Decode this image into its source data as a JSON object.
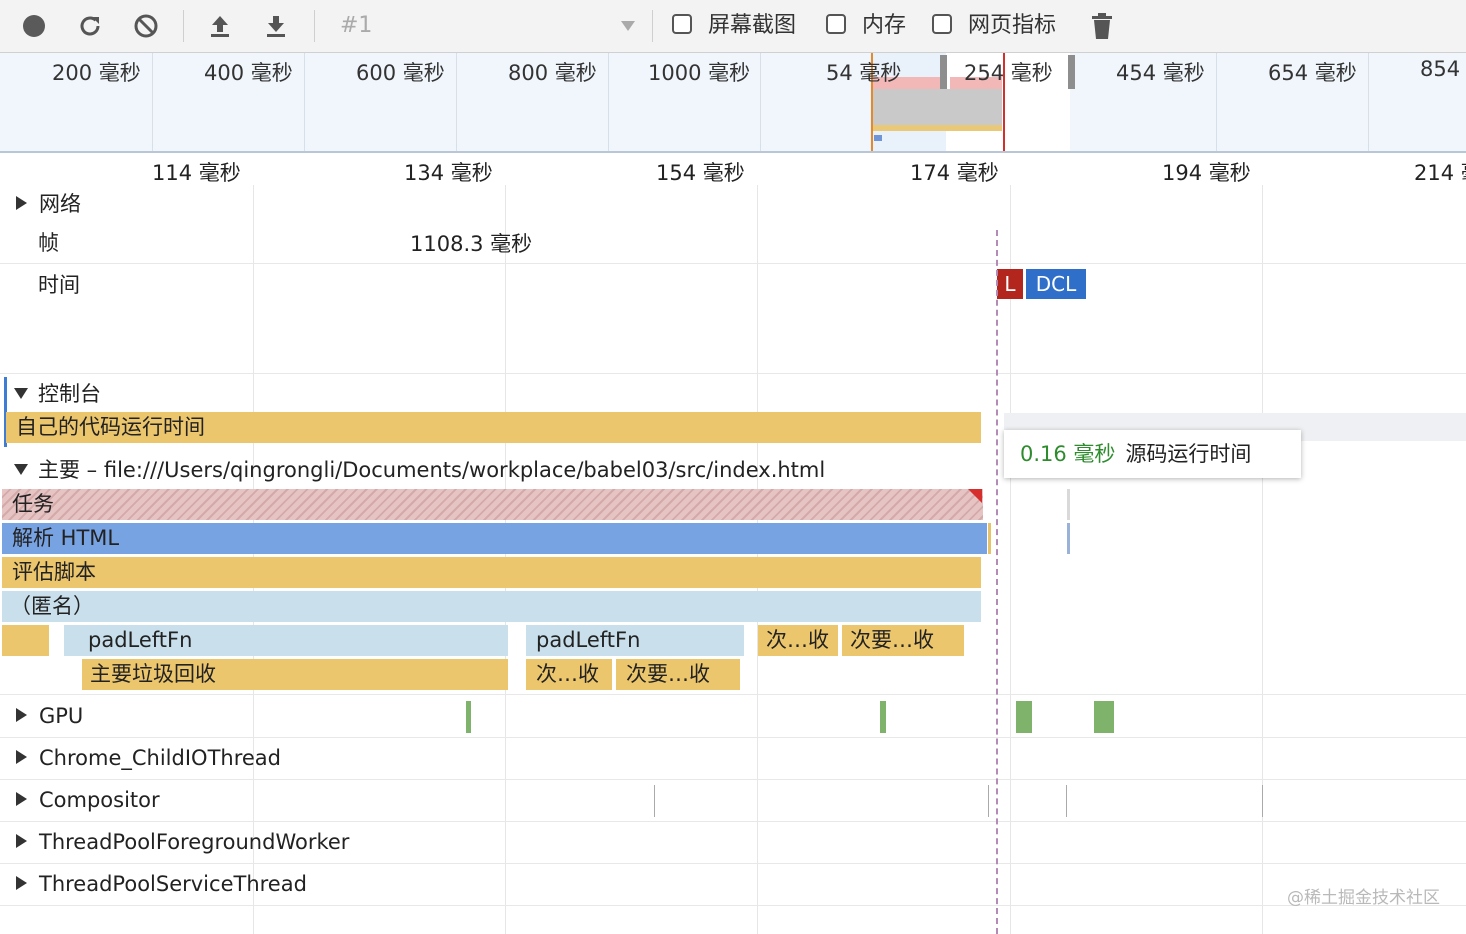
{
  "toolbar": {
    "record_icon": "record-icon",
    "reload_icon": "reload-icon",
    "clear_icon": "clear-icon",
    "upload_icon": "upload-icon",
    "download_icon": "download-icon",
    "profile_selector": "#1",
    "screenshots_label": "屏幕截图",
    "memory_label": "内存",
    "web_vitals_label": "网页指标",
    "trash_icon": "trash-icon"
  },
  "overview": {
    "labels": [
      "200 毫秒",
      "400 毫秒",
      "600 毫秒",
      "800 毫秒",
      "1000 毫秒",
      "54 毫秒",
      "254 毫秒",
      "454 毫秒",
      "654 毫秒",
      "854"
    ]
  },
  "ruler": {
    "labels": [
      "114 毫秒",
      "134 毫秒",
      "154 毫秒",
      "174 毫秒",
      "194 毫秒",
      "214 毫"
    ]
  },
  "tracks": {
    "network": "网络",
    "frames": "帧",
    "frames_value": "1108.3 毫秒",
    "timings": "时间",
    "marker_l": "L",
    "marker_dcl": "DCL",
    "console": "控制台",
    "console_bar": "自己的代码运行时间",
    "main": "主要 – file:///Users/qingrongli/Documents/workplace/babel03/src/index.html",
    "gpu": "GPU",
    "io_thread": "Chrome_ChildIOThread",
    "compositor": "Compositor",
    "pool_fg": "ThreadPoolForegroundWorker",
    "pool_service": "ThreadPoolServiceThread"
  },
  "flame": {
    "task": "任务",
    "parse_html": "解析 HTML",
    "evaluate_script": "评估脚本",
    "anonymous": "（匿名）",
    "padleft_1": "padLeftFn",
    "padleft_2": "padLeftFn",
    "minor_gc_a": "次…收",
    "minor_gc_b": "次要…收",
    "major_gc": "主要垃圾回收",
    "minor_gc_c": "次…收",
    "minor_gc_d": "次要…收"
  },
  "tooltip": {
    "time": "0.16 毫秒",
    "label": "源码运行时间"
  },
  "watermark": "@稀土掘金技术社区",
  "colors": {
    "task_yellow": "#ecc66c",
    "parse_blue": "#78a3e2",
    "anon_lightblue": "#c9e0ec",
    "load_red": "#b3261e",
    "dcl_blue": "#2f6fc9",
    "gpu_green": "#7fb26a"
  }
}
